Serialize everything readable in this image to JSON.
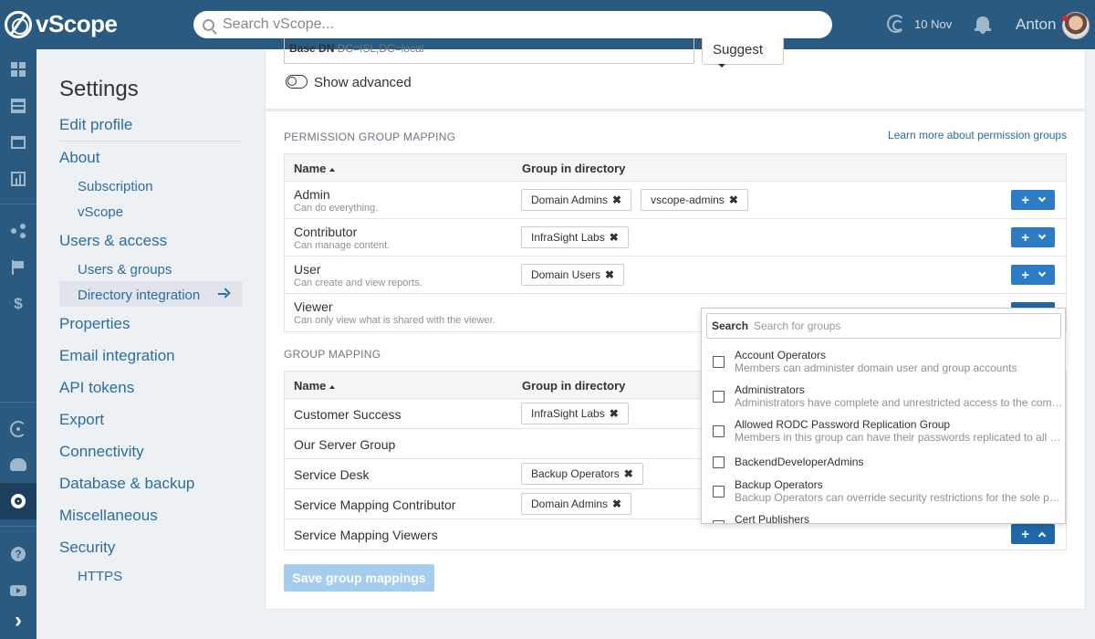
{
  "app": {
    "name": "vScope"
  },
  "topbar": {
    "search_placeholder": "Search vScope...",
    "date": "10 Nov",
    "user": "Anton"
  },
  "rail": {
    "icons": [
      "dashboard-icon",
      "table-icon",
      "window-icon",
      "chart-icon",
      "share-icon",
      "flag-icon",
      "dollar-icon",
      "gauge-icon",
      "cloud-gear-icon",
      "gear-icon",
      "help-icon",
      "video-icon",
      "chevron-right-icon"
    ],
    "dollar": "$",
    "help": "?",
    "expand": "›"
  },
  "settings_nav": {
    "title": "Settings",
    "edit_profile": "Edit profile",
    "about": "About",
    "subscription": "Subscription",
    "vscope": "vScope",
    "users_access": "Users & access",
    "users_groups": "Users & groups",
    "directory_integration": "Directory integration",
    "properties": "Properties",
    "email_integration": "Email integration",
    "api_tokens": "API tokens",
    "export": "Export",
    "connectivity": "Connectivity",
    "database_backup": "Database & backup",
    "miscellaneous": "Miscellaneous",
    "security": "Security",
    "https": "HTTPS"
  },
  "directory": {
    "base_dn_label": "Base DN",
    "base_dn_value": "DC=ISL,DC=local",
    "suggest_label": "Suggest",
    "show_advanced_label": "Show advanced"
  },
  "permission_mapping": {
    "title": "PERMISSION GROUP MAPPING",
    "learn_more": "Learn more about permission groups",
    "col_name": "Name",
    "col_group": "Group in directory",
    "rows": [
      {
        "name": "Admin",
        "desc": "Can do everything.",
        "groups": [
          "Domain Admins",
          "vscope-admins"
        ]
      },
      {
        "name": "Contributor",
        "desc": "Can manage content.",
        "groups": [
          "InfraSight Labs"
        ]
      },
      {
        "name": "User",
        "desc": "Can create and view reports.",
        "groups": [
          "Domain Users"
        ]
      },
      {
        "name": "Viewer",
        "desc": "Can only view what is shared with the viewer.",
        "groups": []
      }
    ]
  },
  "group_mapping": {
    "title": "GROUP MAPPING",
    "col_name": "Name",
    "col_group": "Group in directory",
    "rows": [
      {
        "name": "Customer Success",
        "groups": [
          "InfraSight Labs"
        ]
      },
      {
        "name": "Our Server Group",
        "groups": []
      },
      {
        "name": "Service Desk",
        "groups": [
          "Backup Operators"
        ]
      },
      {
        "name": "Service Mapping Contributor",
        "groups": [
          "Domain Admins"
        ]
      },
      {
        "name": "Service Mapping Viewers",
        "groups": []
      }
    ],
    "save_label": "Save group mappings"
  },
  "dropdown": {
    "search_label": "Search",
    "search_placeholder": "Search for groups",
    "items": [
      {
        "name": "Account Operators",
        "desc": "Members can administer domain user and group accounts"
      },
      {
        "name": "Administrators",
        "desc": "Administrators have complete and unrestricted access to the computer/domain"
      },
      {
        "name": "Allowed RODC Password Replication Group",
        "desc": "Members in this group can have their passwords replicated to all read-only domain controllers"
      },
      {
        "name": "BackendDeveloperAdmins",
        "desc": ""
      },
      {
        "name": "Backup Operators",
        "desc": "Backup Operators can override security restrictions for the sole purpose of backing up or restoring files"
      },
      {
        "name": "Cert Publishers",
        "desc": ""
      }
    ]
  },
  "colors": {
    "topbar": "#2a5a80",
    "rail_active": "#1b3f5c",
    "link": "#2b6ca3",
    "button": "#2b7cc4",
    "button_disabled": "#a6cdef"
  }
}
